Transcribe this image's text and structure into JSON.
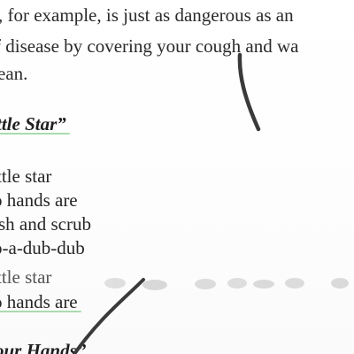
{
  "document": {
    "paragraph_lines": [
      ", for example, is just as dangerous as an",
      "f disease by covering your cough and wa",
      "ean."
    ],
    "song1_title": "ttle Star”",
    "song1_lines": [
      "ttle star",
      "o hands are",
      "sh and scrub",
      "o-a-dub-dub",
      "ttle star",
      "o hands are"
    ],
    "song2_title": "our Hands”"
  },
  "colors": {
    "text": "#262626",
    "underline": "#9ad6a0",
    "pen_stroke": "#3a3a3a",
    "smudge": "#b8b8b8"
  }
}
